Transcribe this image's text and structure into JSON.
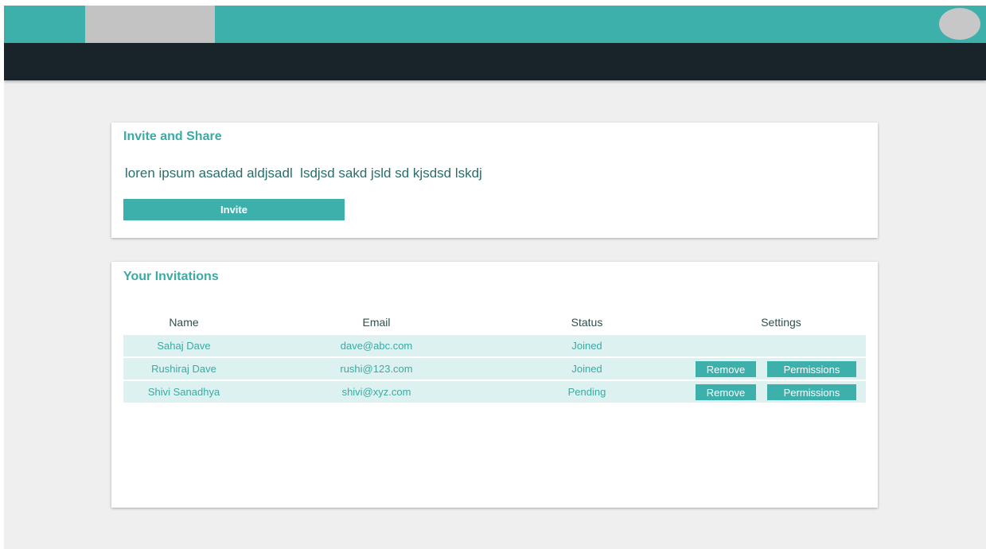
{
  "invite_card": {
    "title": "Invite and Share",
    "description": "loren ipsum asadad aldjsadl  lsdjsd sakd jsld sd kjsdsd lskdj",
    "invite_label": "Invite"
  },
  "invitations_card": {
    "title": "Your Invitations",
    "columns": [
      "Name",
      "Email",
      "Status",
      "Settings"
    ],
    "rows": [
      {
        "name": "Sahaj Dave",
        "email": "dave@abc.com",
        "status": "Joined"
      },
      {
        "name": "Rushiraj Dave",
        "email": "rushi@123.com",
        "status": "Joined",
        "remove_label": "Remove",
        "permissions_label": "Permissions"
      },
      {
        "name": "Shivi Sanadhya",
        "email": "shivi@xyz.com",
        "status": "Pending",
        "remove_label": "Remove",
        "permissions_label": "Permissions"
      }
    ]
  },
  "colors": {
    "accent": "#3db0ab",
    "navbar": "#18232a",
    "row_background": "#dcf1f0",
    "page_background": "#efefef"
  },
  "icons": [
    "avatar-icon",
    "logo-placeholder"
  ]
}
